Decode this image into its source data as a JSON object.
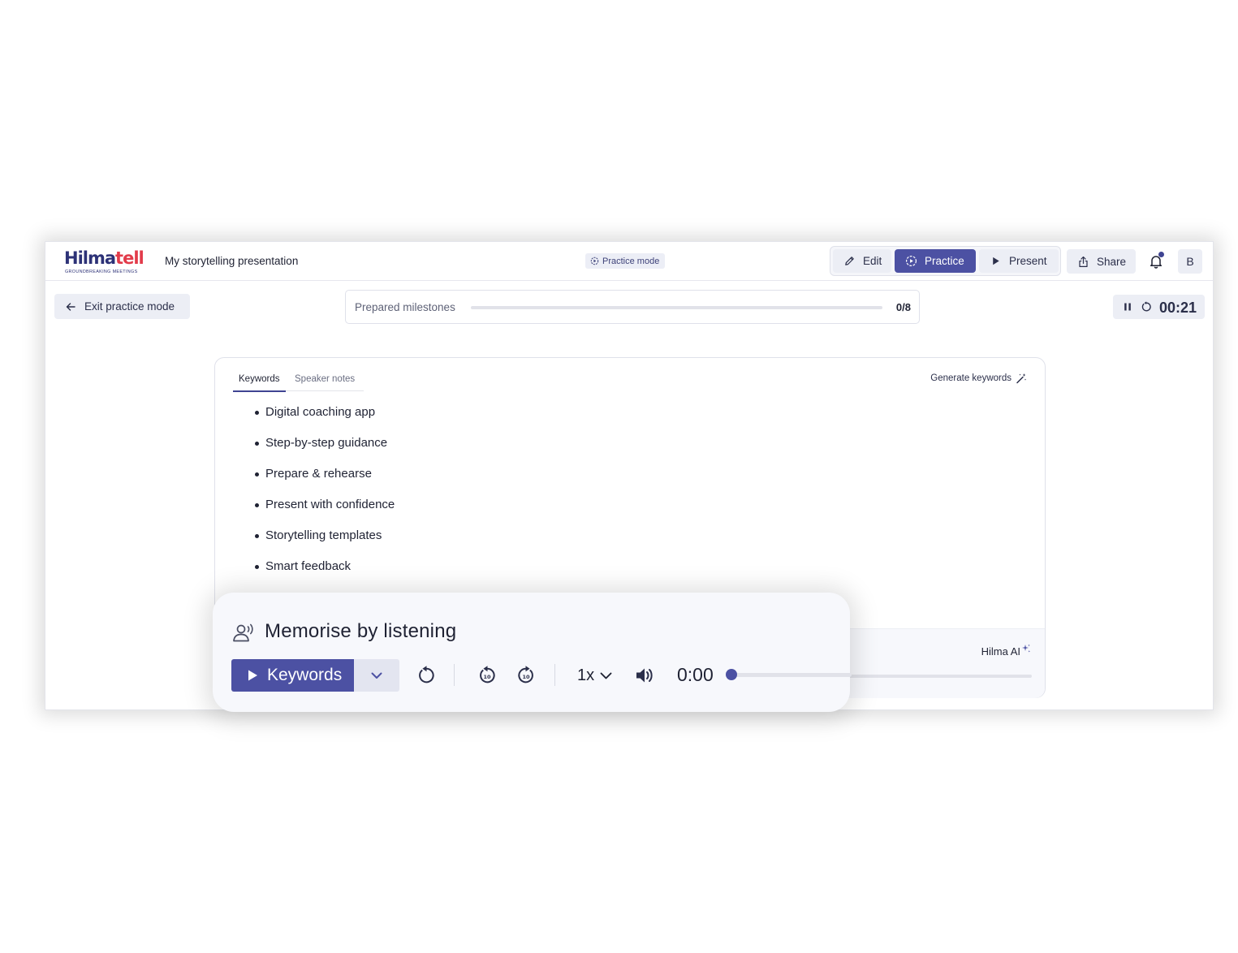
{
  "header": {
    "logo_text_main": "Hilma",
    "logo_text_accent": "tell",
    "logo_tagline": "GROUNDBREAKING MEETINGS",
    "document_title": "My storytelling presentation",
    "mode_badge": "Practice mode",
    "modes": {
      "edit": "Edit",
      "practice": "Practice",
      "present": "Present"
    },
    "active_mode": "practice",
    "share": "Share",
    "avatar_initial": "B"
  },
  "toolbar": {
    "exit_label": "Exit practice mode",
    "milestones_label": "Prepared milestones",
    "milestones_done": 0,
    "milestones_total": 8,
    "milestones_count": "0/8",
    "timer": "00:21"
  },
  "notes": {
    "tabs": [
      "Keywords",
      "Speaker notes"
    ],
    "active_tab": "Keywords",
    "generate_label": "Generate keywords",
    "keywords": [
      "Digital coaching app",
      "Step-by-step guidance",
      "Prepare & rehearse",
      "Present with confidence",
      "Storytelling templates",
      "Smart feedback"
    ],
    "ai_label": "Hilma AI"
  },
  "player": {
    "title": "Memorise by listening",
    "play_label": "Keywords",
    "speed": "1x",
    "time": "0:00",
    "progress": 0
  },
  "colors": {
    "accent": "#4c51a3",
    "logo_navy": "#2d3277",
    "logo_red": "#e23b4a",
    "neutral_button": "#eceef5"
  },
  "icons": [
    "pencil-icon",
    "practice-play-circle-icon",
    "play-icon",
    "share-icon",
    "bell-icon",
    "arrow-left-icon",
    "pause-icon",
    "reset-icon",
    "magic-wand-icon",
    "sparkle-icon",
    "listening-person-icon",
    "chevron-down-icon",
    "replay-icon",
    "rewind-10-icon",
    "forward-10-icon",
    "volume-icon"
  ]
}
